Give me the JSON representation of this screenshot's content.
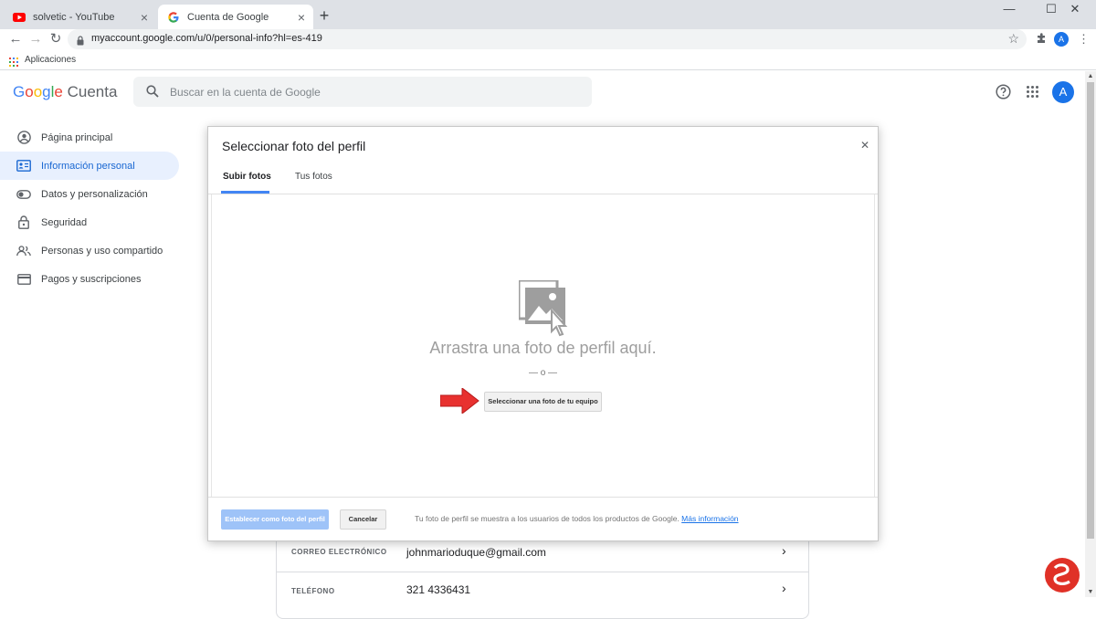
{
  "browser": {
    "tabs": [
      {
        "title": "solvetic - YouTube",
        "active": false,
        "icon": "youtube-icon"
      },
      {
        "title": "Cuenta de Google",
        "active": true,
        "icon": "google-g-icon"
      }
    ],
    "url": "myaccount.google.com/u/0/personal-info?hl=es-419",
    "bookmarks_label": "Aplicaciones",
    "profile_initial": "A"
  },
  "header": {
    "logo_google": [
      "G",
      "o",
      "o",
      "g",
      "l",
      "e"
    ],
    "product": "Cuenta",
    "search_placeholder": "Buscar en la cuenta de Google",
    "avatar_initial": "A"
  },
  "sidebar": {
    "items": [
      {
        "label": "Página principal",
        "icon": "account-circle-icon",
        "active": false
      },
      {
        "label": "Información personal",
        "icon": "id-card-icon",
        "active": true
      },
      {
        "label": "Datos y personalización",
        "icon": "toggle-icon",
        "active": false
      },
      {
        "label": "Seguridad",
        "icon": "lock-icon",
        "active": false
      },
      {
        "label": "Personas y uso compartido",
        "icon": "people-icon",
        "active": false
      },
      {
        "label": "Pagos y suscripciones",
        "icon": "credit-card-icon",
        "active": false
      }
    ]
  },
  "contact": {
    "rows": [
      {
        "label": "CORREO ELECTRÓNICO",
        "value": "johnmarioduque@gmail.com"
      },
      {
        "label": "TELÉFONO",
        "value": "321 4336431"
      }
    ]
  },
  "dialog": {
    "title": "Seleccionar foto del perfil",
    "tabs": [
      {
        "label": "Subir fotos",
        "active": true
      },
      {
        "label": "Tus fotos",
        "active": false
      }
    ],
    "drag_text": "Arrastra una foto de perfil aquí.",
    "or_text": "— o —",
    "select_button": "Seleccionar una foto de tu equipo",
    "set_button": "Establecer como foto del perfil",
    "cancel_button": "Cancelar",
    "footer_note": "Tu foto de perfil se muestra a los usuarios de todos los productos de Google.",
    "footer_link": "Más información"
  },
  "colors": {
    "accent": "#1a73e8",
    "active_bg": "#e8f0fe",
    "arrow": "#e8312f"
  }
}
